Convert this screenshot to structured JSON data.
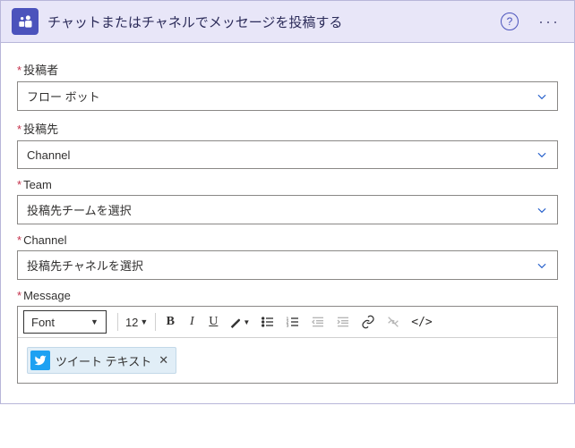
{
  "header": {
    "title": "チャットまたはチャネルでメッセージを投稿する"
  },
  "fields": {
    "postAs": {
      "label": "投稿者",
      "value": "フロー ボット"
    },
    "postIn": {
      "label": "投稿先",
      "value": "Channel"
    },
    "team": {
      "label": "Team",
      "placeholder": "投稿先チームを選択"
    },
    "channel": {
      "label": "Channel",
      "placeholder": "投稿先チャネルを選択"
    },
    "message": {
      "label": "Message"
    }
  },
  "toolbar": {
    "font": "Font",
    "size": "12"
  },
  "token": {
    "label": "ツイート テキスト"
  }
}
